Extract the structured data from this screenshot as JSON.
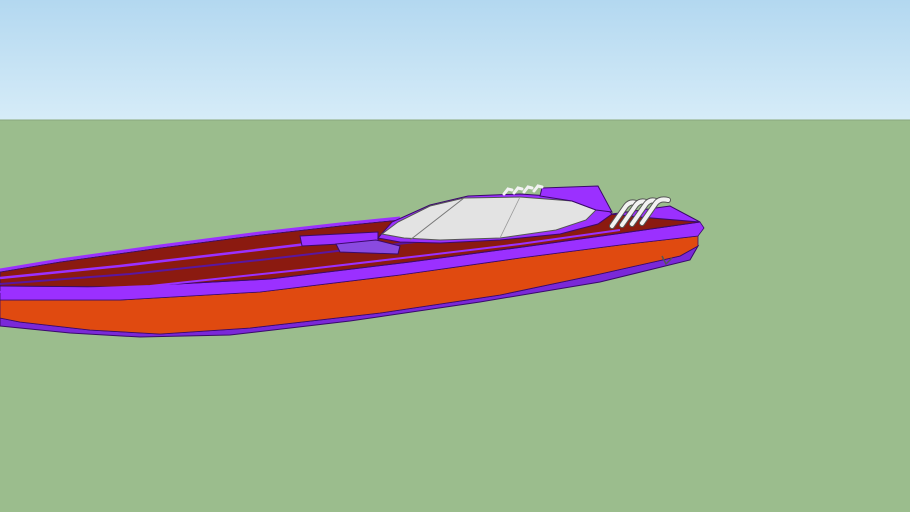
{
  "scene": {
    "sky_color_top": "#b3d8f0",
    "sky_color_horizon": "#d6ecf8",
    "ground_color": "#9bbd8d",
    "horizon_line_color": "#8aa87d"
  },
  "boat": {
    "hull_top_color": "#8b1a10",
    "stripe_purple_color": "#9b30ff",
    "stripe_orange_color": "#e04a10",
    "hull_bottom_color": "#7a28d8",
    "outline_color": "#3a0a6a",
    "windshield_color": "#e3e3e3",
    "windshield_shadow_color": "#c9c9c9",
    "exhaust_pipe_color": "#f2f2f2",
    "exhaust_pipe_count": 4
  }
}
